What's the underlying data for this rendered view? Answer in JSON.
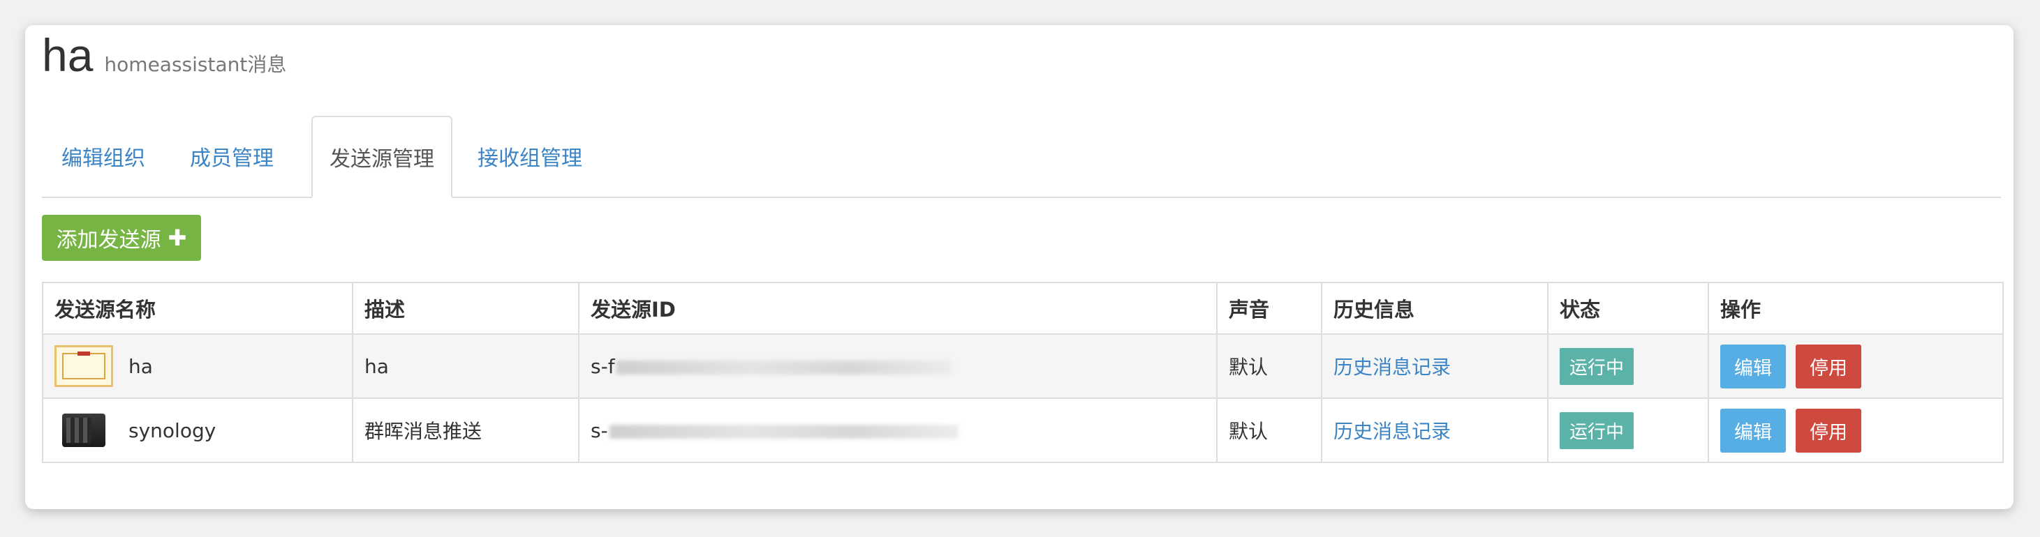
{
  "header": {
    "org_name": "ha",
    "org_desc": "homeassistant消息"
  },
  "tabs": [
    {
      "label": "编辑组织",
      "active": false
    },
    {
      "label": "成员管理",
      "active": false
    },
    {
      "label": "发送源管理",
      "active": true
    },
    {
      "label": "接收组管理",
      "active": false
    }
  ],
  "toolbar": {
    "add_label": "添加发送源",
    "add_icon": "plus-icon",
    "add_color": "#76b544"
  },
  "table": {
    "headers": [
      "发送源名称",
      "描述",
      "发送源ID",
      "声音",
      "历史信息",
      "状态",
      "操作"
    ],
    "rows": [
      {
        "name": "ha",
        "avatar": "certificate-icon",
        "description": "ha",
        "id_prefix": "s-f",
        "sound": "默认",
        "history": "历史消息记录",
        "status": "运行中",
        "edit": "编辑",
        "disable": "停用"
      },
      {
        "name": "synology",
        "avatar": "nas-device-icon",
        "description": "群晖消息推送",
        "id_prefix": "s-",
        "sound": "默认",
        "history": "历史消息记录",
        "status": "运行中",
        "edit": "编辑",
        "disable": "停用"
      }
    ]
  },
  "colors": {
    "link": "#3b84c5",
    "status": "#5bb3a8",
    "edit": "#56aee4",
    "disable": "#cf4a3e"
  }
}
